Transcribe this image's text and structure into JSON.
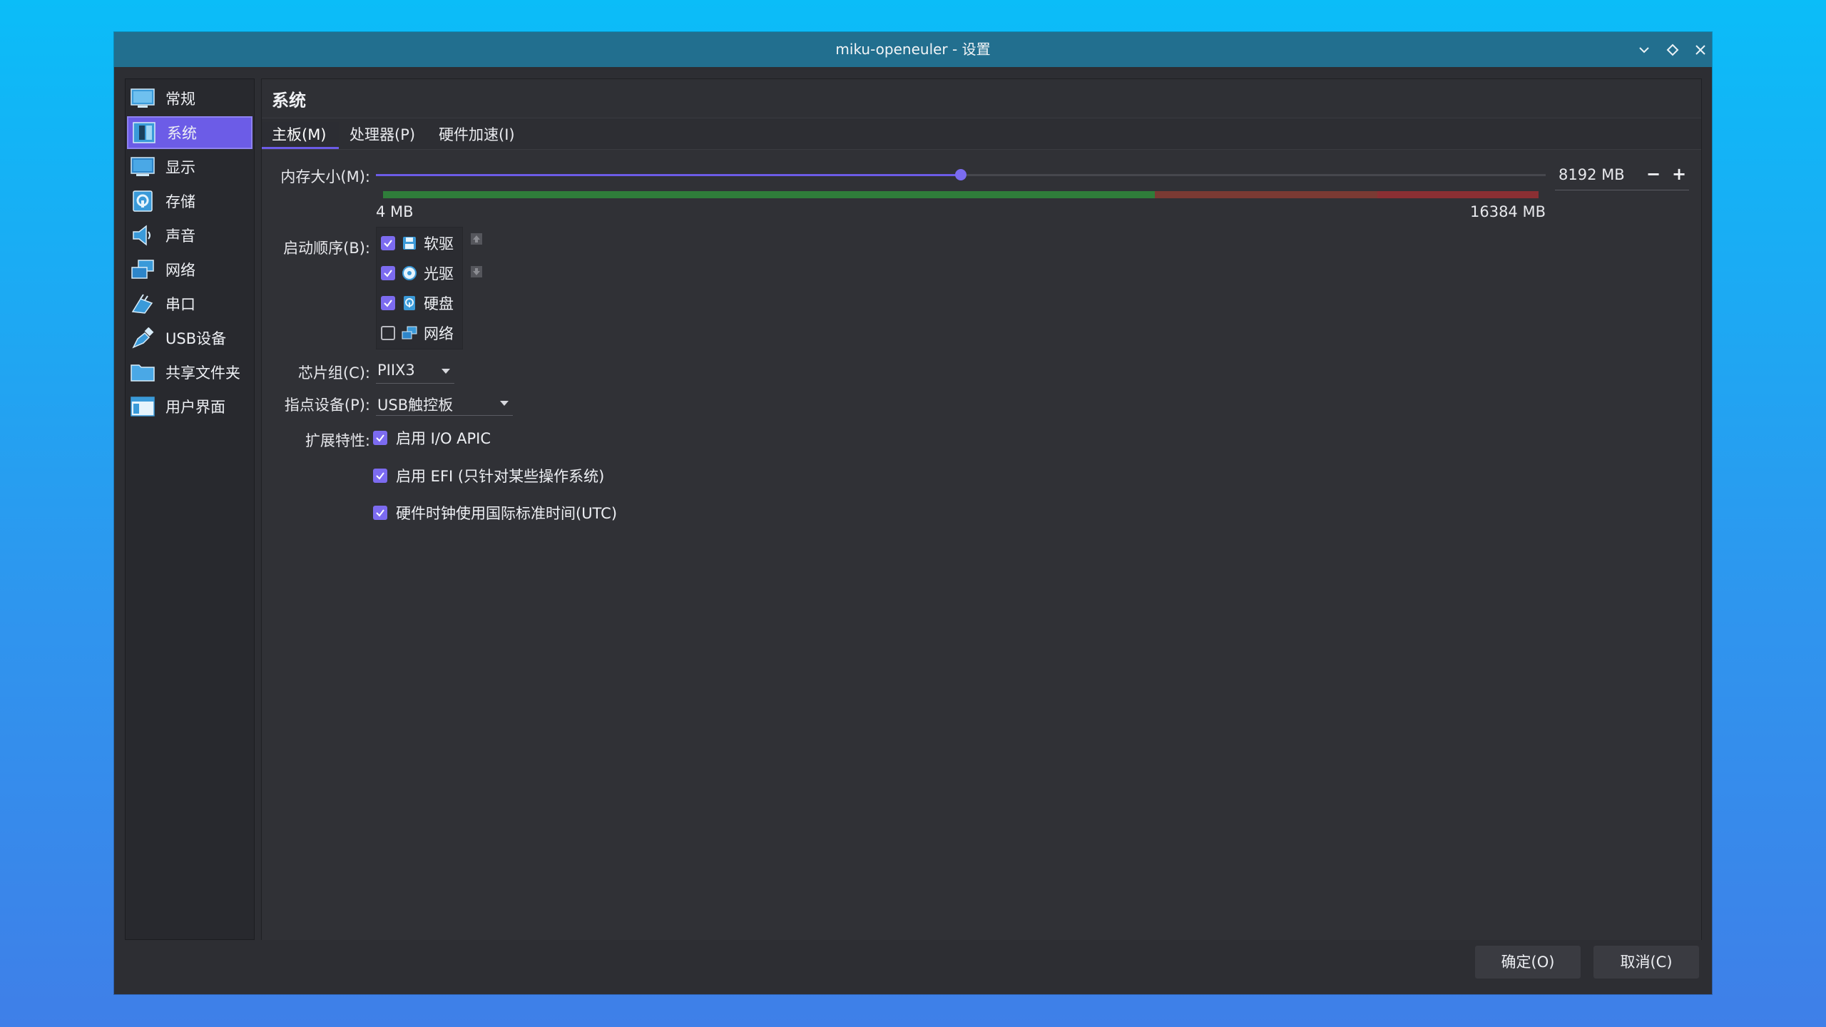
{
  "window": {
    "title": "miku-openeuler - 设置"
  },
  "titlebar_buttons": [
    "minimize-icon",
    "maximize-icon",
    "close-icon"
  ],
  "sidebar": {
    "items": [
      {
        "label": "常规",
        "icon": "general-icon",
        "active": false
      },
      {
        "label": "系统",
        "icon": "system-icon",
        "active": true
      },
      {
        "label": "显示",
        "icon": "display-icon",
        "active": false
      },
      {
        "label": "存储",
        "icon": "storage-icon",
        "active": false
      },
      {
        "label": "声音",
        "icon": "audio-icon",
        "active": false
      },
      {
        "label": "网络",
        "icon": "network-icon",
        "active": false
      },
      {
        "label": "串口",
        "icon": "serial-port-icon",
        "active": false
      },
      {
        "label": "USB设备",
        "icon": "usb-icon",
        "active": false
      },
      {
        "label": "共享文件夹",
        "icon": "shared-folder-icon",
        "active": false
      },
      {
        "label": "用户界面",
        "icon": "user-interface-icon",
        "active": false
      }
    ]
  },
  "page": {
    "title": "系统"
  },
  "tabs": [
    {
      "label": "主板(M)",
      "active": true
    },
    {
      "label": "处理器(P)",
      "active": false
    },
    {
      "label": "硬件加速(I)",
      "active": false
    }
  ],
  "motherboard": {
    "memory_label": "内存大小(M):",
    "memory_value": "8192 MB",
    "memory_min": "4 MB",
    "memory_max": "16384 MB",
    "memory_fraction": 0.5,
    "boot_order_label": "启动顺序(B):",
    "boot_devices": [
      {
        "label": "软驱",
        "checked": true,
        "icon": "floppy-icon"
      },
      {
        "label": "光驱",
        "checked": true,
        "icon": "optical-disc-icon"
      },
      {
        "label": "硬盘",
        "checked": true,
        "icon": "hard-disk-icon"
      },
      {
        "label": "网络",
        "checked": false,
        "icon": "network-icon"
      }
    ],
    "chipset_label": "芯片组(C):",
    "chipset_value": "PIIX3",
    "pointing_label": "指点设备(P):",
    "pointing_value": "USB触控板",
    "features_label": "扩展特性:",
    "features": [
      {
        "label": "启用 I/O APIC",
        "checked": true
      },
      {
        "label": "启用 EFI (只针对某些操作系统)",
        "checked": true
      },
      {
        "label": "硬件时钟使用国际标准时间(UTC)",
        "checked": true
      }
    ]
  },
  "buttons": {
    "ok": "确定(O)",
    "cancel": "取消(C)"
  },
  "colors": {
    "accent": "#6c5ce7",
    "titlebar": "#226f8f",
    "background": "#2d2e33"
  }
}
